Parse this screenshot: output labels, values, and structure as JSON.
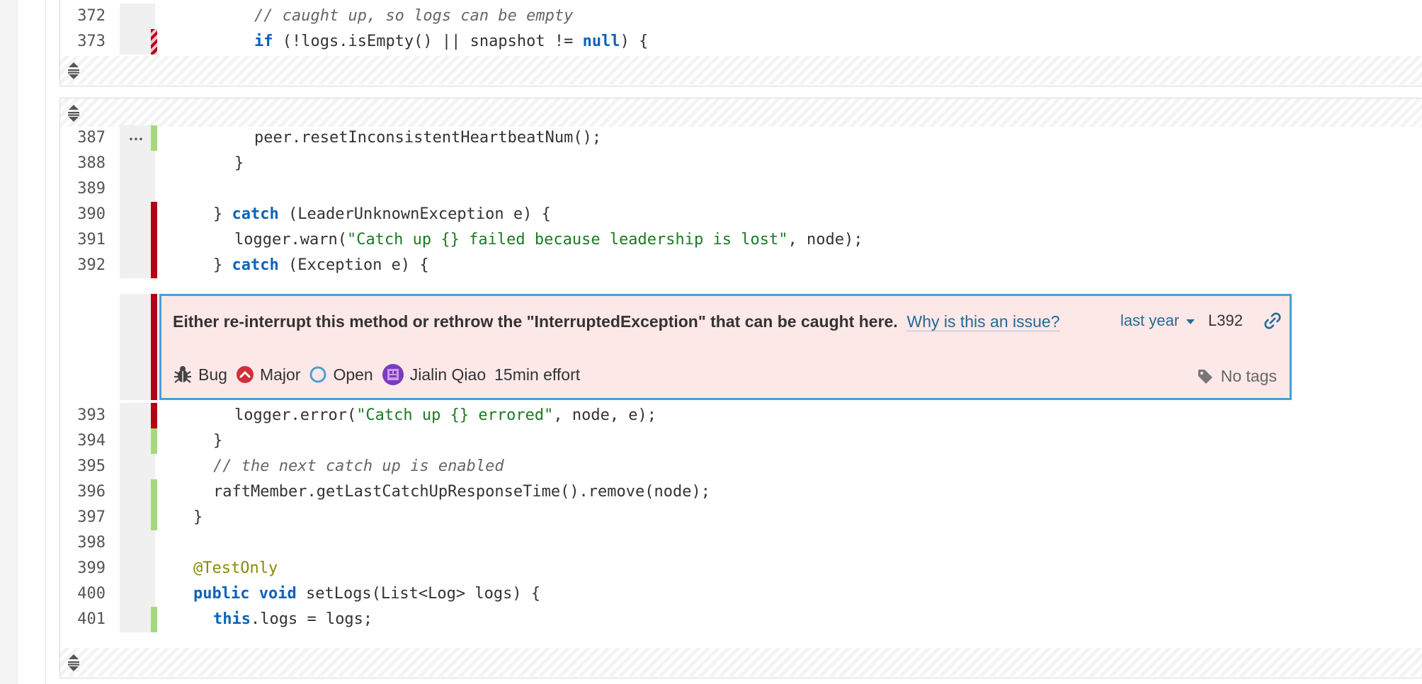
{
  "block1": {
    "lines": [
      {
        "num": "372",
        "text": "// caught up, so logs can be empty"
      },
      {
        "num": "373",
        "parts": [
          "if",
          " (!logs.isEmpty() || snapshot != ",
          "null",
          ") {"
        ]
      }
    ]
  },
  "block2": {
    "lines": [
      {
        "num": "387",
        "dots": "…",
        "text": "peer.resetInconsistentHeartbeatNum();"
      },
      {
        "num": "388",
        "text": "}"
      },
      {
        "num": "389",
        "text": ""
      },
      {
        "num": "390",
        "parts": [
          "} ",
          "catch",
          " (LeaderUnknownException e) {"
        ]
      },
      {
        "num": "391",
        "parts": [
          "logger.warn(",
          "\"Catch up {} failed because leadership is lost\"",
          ", node);"
        ]
      },
      {
        "num": "392",
        "parts": [
          "} ",
          "catch",
          " (Exception e) {"
        ]
      },
      {
        "num": "393",
        "parts": [
          "logger.error(",
          "\"Catch up {} errored\"",
          ", node, e);"
        ]
      },
      {
        "num": "394",
        "text": "}"
      },
      {
        "num": "395",
        "text": "// the next catch up is enabled"
      },
      {
        "num": "396",
        "text": "raftMember.getLastCatchUpResponseTime().remove(node);"
      },
      {
        "num": "397",
        "text": "}"
      },
      {
        "num": "398",
        "text": ""
      },
      {
        "num": "399",
        "text": "@TestOnly"
      },
      {
        "num": "400",
        "parts": [
          "public",
          " ",
          "void",
          " setLogs(List<Log> logs) {"
        ]
      },
      {
        "num": "401",
        "parts": [
          "this",
          ".logs = logs;"
        ]
      }
    ]
  },
  "issue": {
    "message": "Either re-interrupt this method or rethrow the \"InterruptedException\" that can be caught here.",
    "why_link": "Why is this an issue?",
    "date": "last year",
    "line_ref": "L392",
    "type": "Bug",
    "severity": "Major",
    "status": "Open",
    "assignee": "Jialin Qiao",
    "effort": "15min effort",
    "tags": "No tags"
  },
  "colors": {
    "removed_bar": "#b30015",
    "added_bar": "#a8d87c",
    "issue_bg": "#fde8e8",
    "issue_border": "#4b9fd5",
    "keyword": "#0e63b8",
    "string": "#1a7a22"
  }
}
